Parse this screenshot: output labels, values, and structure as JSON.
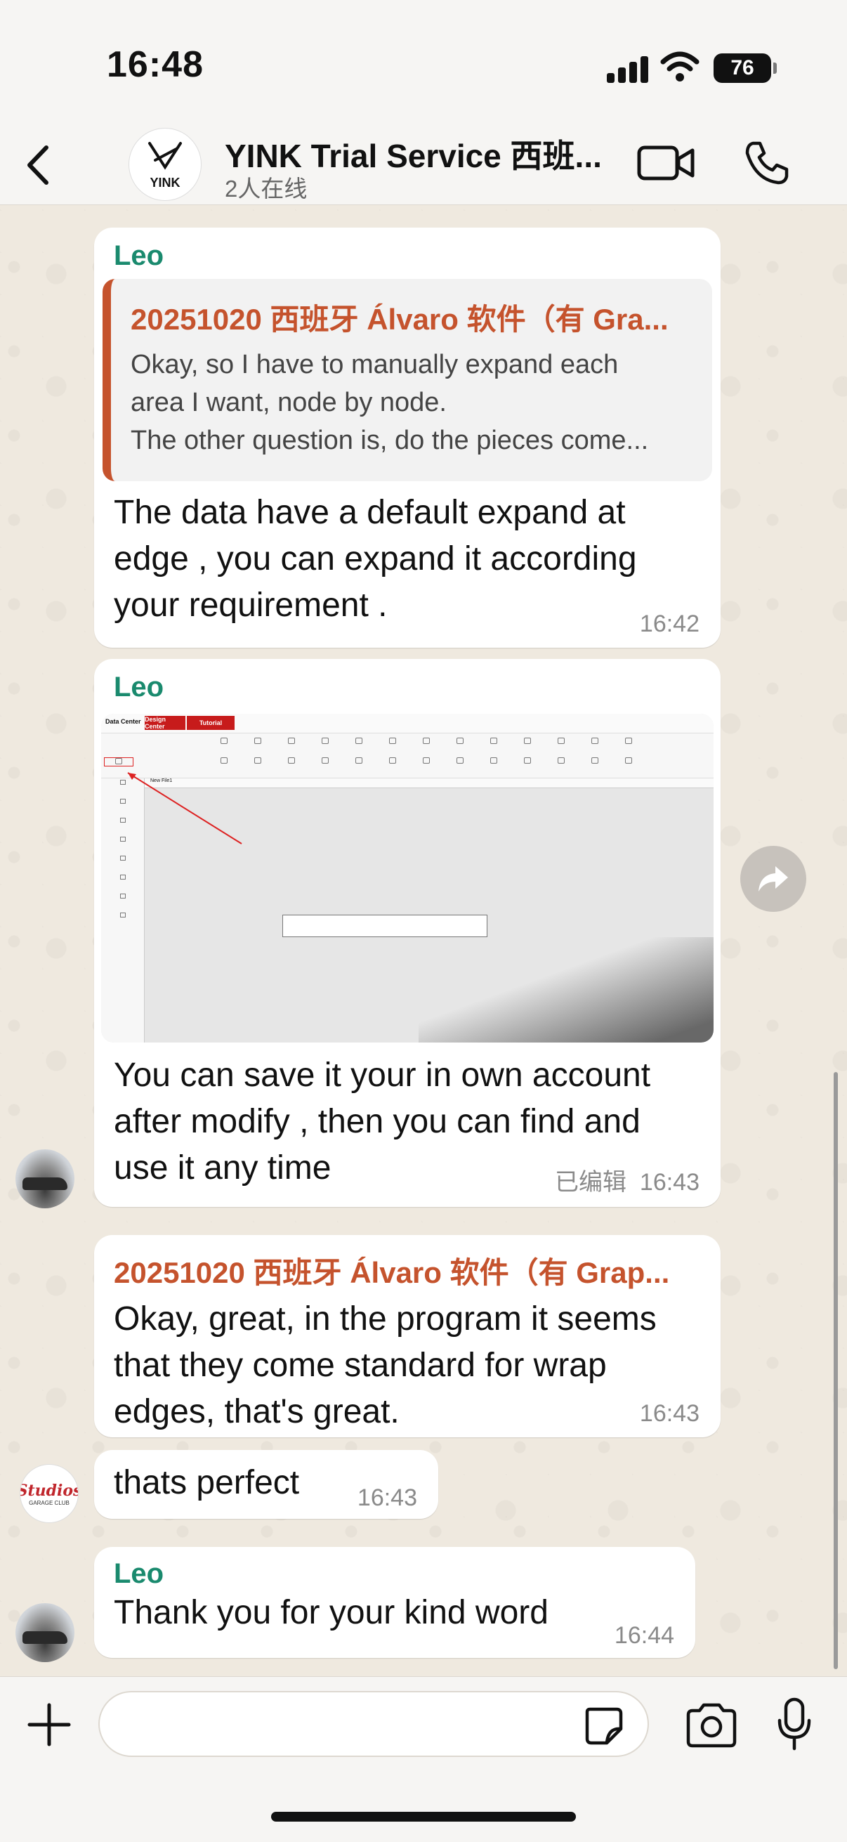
{
  "status_bar": {
    "time": "16:48",
    "battery": "76"
  },
  "header": {
    "title": "YINK Trial Service 西班...",
    "subtitle": "2人在线",
    "avatar_text": "YINK"
  },
  "messages": [
    {
      "sender": "Leo",
      "quote_title": "20251020 西班牙 Álvaro 软件（有 Gra...",
      "quote_lines": [
        "Okay, so I have to manually expand each",
        "area I want, node by node.",
        "The other question is, do the pieces come..."
      ],
      "lines": [
        "The data have a default expand at",
        "edge , you can expand it according",
        "your requirement ."
      ],
      "time": "16:42"
    },
    {
      "sender": "Leo",
      "image_ui": {
        "tab_data_center": "Data Center",
        "tab_design_center": "Design Center",
        "tab_tutorial": "Tutorial",
        "canvas_tab": "New File1"
      },
      "lines": [
        "You can save it your in own account",
        "after modify , then you can find and",
        "use it any time"
      ],
      "edited": "已编辑",
      "time": "16:43"
    },
    {
      "reply_title": "20251020 西班牙 Álvaro 软件（有 Grap...",
      "lines": [
        "Okay, great, in the program it seems",
        "that they come standard for wrap",
        "edges, that's great."
      ],
      "time": "16:43"
    },
    {
      "text": "thats perfect",
      "time": "16:43",
      "avatar_text": "Studios",
      "avatar_sub": "GARAGE CLUB"
    },
    {
      "sender": "Leo",
      "text": "Thank you for your kind word",
      "time": "16:44"
    }
  ],
  "input": {
    "placeholder": ""
  },
  "colors": {
    "sender": "#1a8a6e",
    "quote_accent": "#c5532d",
    "background": "#efe9df"
  }
}
